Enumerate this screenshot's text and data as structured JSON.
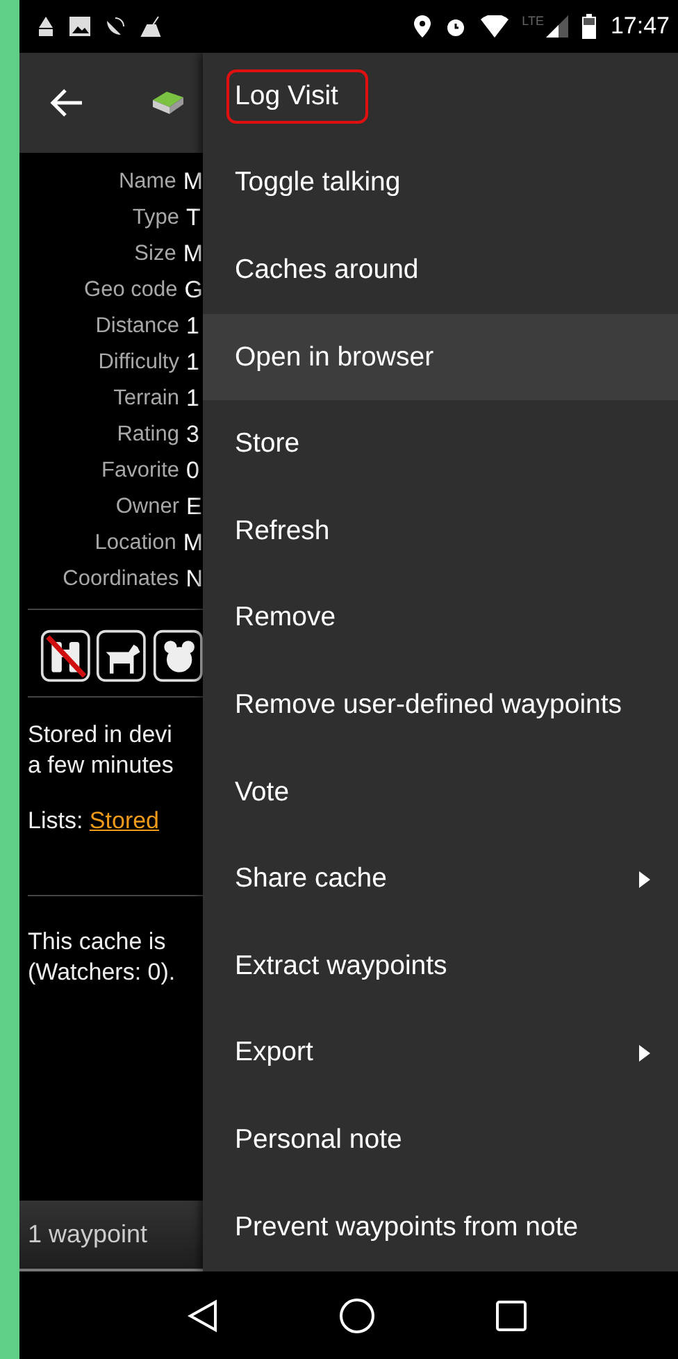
{
  "status_bar": {
    "time": "17:47",
    "network": "LTE"
  },
  "details": [
    {
      "label": "Name",
      "value": "M"
    },
    {
      "label": "Type",
      "value": "T"
    },
    {
      "label": "Size",
      "value": "M"
    },
    {
      "label": "Geo code",
      "value": "G"
    },
    {
      "label": "Distance",
      "value": "1"
    },
    {
      "label": "Difficulty",
      "value": "1"
    },
    {
      "label": "Terrain",
      "value": "1"
    },
    {
      "label": "Rating",
      "value": "3"
    },
    {
      "label": "Favorite",
      "value": "0"
    },
    {
      "label": "Owner",
      "value": "E"
    },
    {
      "label": "Location",
      "value": "M"
    },
    {
      "label": "Coordinates",
      "value": "N"
    }
  ],
  "attributes": [
    {
      "kind": "binoculars",
      "crossed": true
    },
    {
      "kind": "dog",
      "crossed": false
    },
    {
      "kind": "teddy",
      "crossed": false
    }
  ],
  "storage": {
    "lines": [
      "Stored in devi",
      "a few minutes"
    ],
    "lists_label": "Lists:",
    "lists_link": "Stored"
  },
  "watch": {
    "lines": [
      "This cache is",
      "(Watchers: 0)."
    ]
  },
  "waypoints_bar": "1 waypoint",
  "menu": [
    {
      "label": "Log Visit",
      "selected": false,
      "outlined": true,
      "submenu": false
    },
    {
      "label": "Toggle talking",
      "selected": false,
      "outlined": false,
      "submenu": false
    },
    {
      "label": "Caches around",
      "selected": false,
      "outlined": false,
      "submenu": false
    },
    {
      "label": "Open in browser",
      "selected": true,
      "outlined": false,
      "submenu": false
    },
    {
      "label": "Store",
      "selected": false,
      "outlined": false,
      "submenu": false
    },
    {
      "label": "Refresh",
      "selected": false,
      "outlined": false,
      "submenu": false
    },
    {
      "label": "Remove",
      "selected": false,
      "outlined": false,
      "submenu": false
    },
    {
      "label": "Remove user-defined waypoints",
      "selected": false,
      "outlined": false,
      "submenu": false
    },
    {
      "label": "Vote",
      "selected": false,
      "outlined": false,
      "submenu": false
    },
    {
      "label": "Share cache",
      "selected": false,
      "outlined": false,
      "submenu": true
    },
    {
      "label": "Extract waypoints",
      "selected": false,
      "outlined": false,
      "submenu": false
    },
    {
      "label": "Export",
      "selected": false,
      "outlined": false,
      "submenu": true
    },
    {
      "label": "Personal note",
      "selected": false,
      "outlined": false,
      "submenu": false
    },
    {
      "label": "Prevent waypoints from note",
      "selected": false,
      "outlined": false,
      "submenu": false
    }
  ]
}
